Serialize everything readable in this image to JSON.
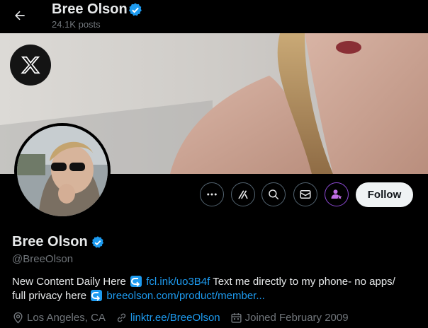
{
  "header": {
    "name": "Bree Olson",
    "posts": "24.1K posts"
  },
  "profile": {
    "name": "Bree Olson",
    "handle": "@BreeOlson",
    "follow_label": "Follow"
  },
  "bio": {
    "line1_text": "New Content Daily Here",
    "link1": "fcl.ink/uo3B4f",
    "line1_suffix": "Text me directly to my phone- no apps/",
    "line2_prefix": "full privacy here",
    "link2": "breeolson.com/product/member..."
  },
  "meta": {
    "location": "Los Angeles, CA",
    "website": "linktr.ee/BreeOlson",
    "joined": "Joined February 2009"
  },
  "colors": {
    "accent": "#1d9bf0",
    "background": "#000000",
    "muted": "#71767b"
  }
}
